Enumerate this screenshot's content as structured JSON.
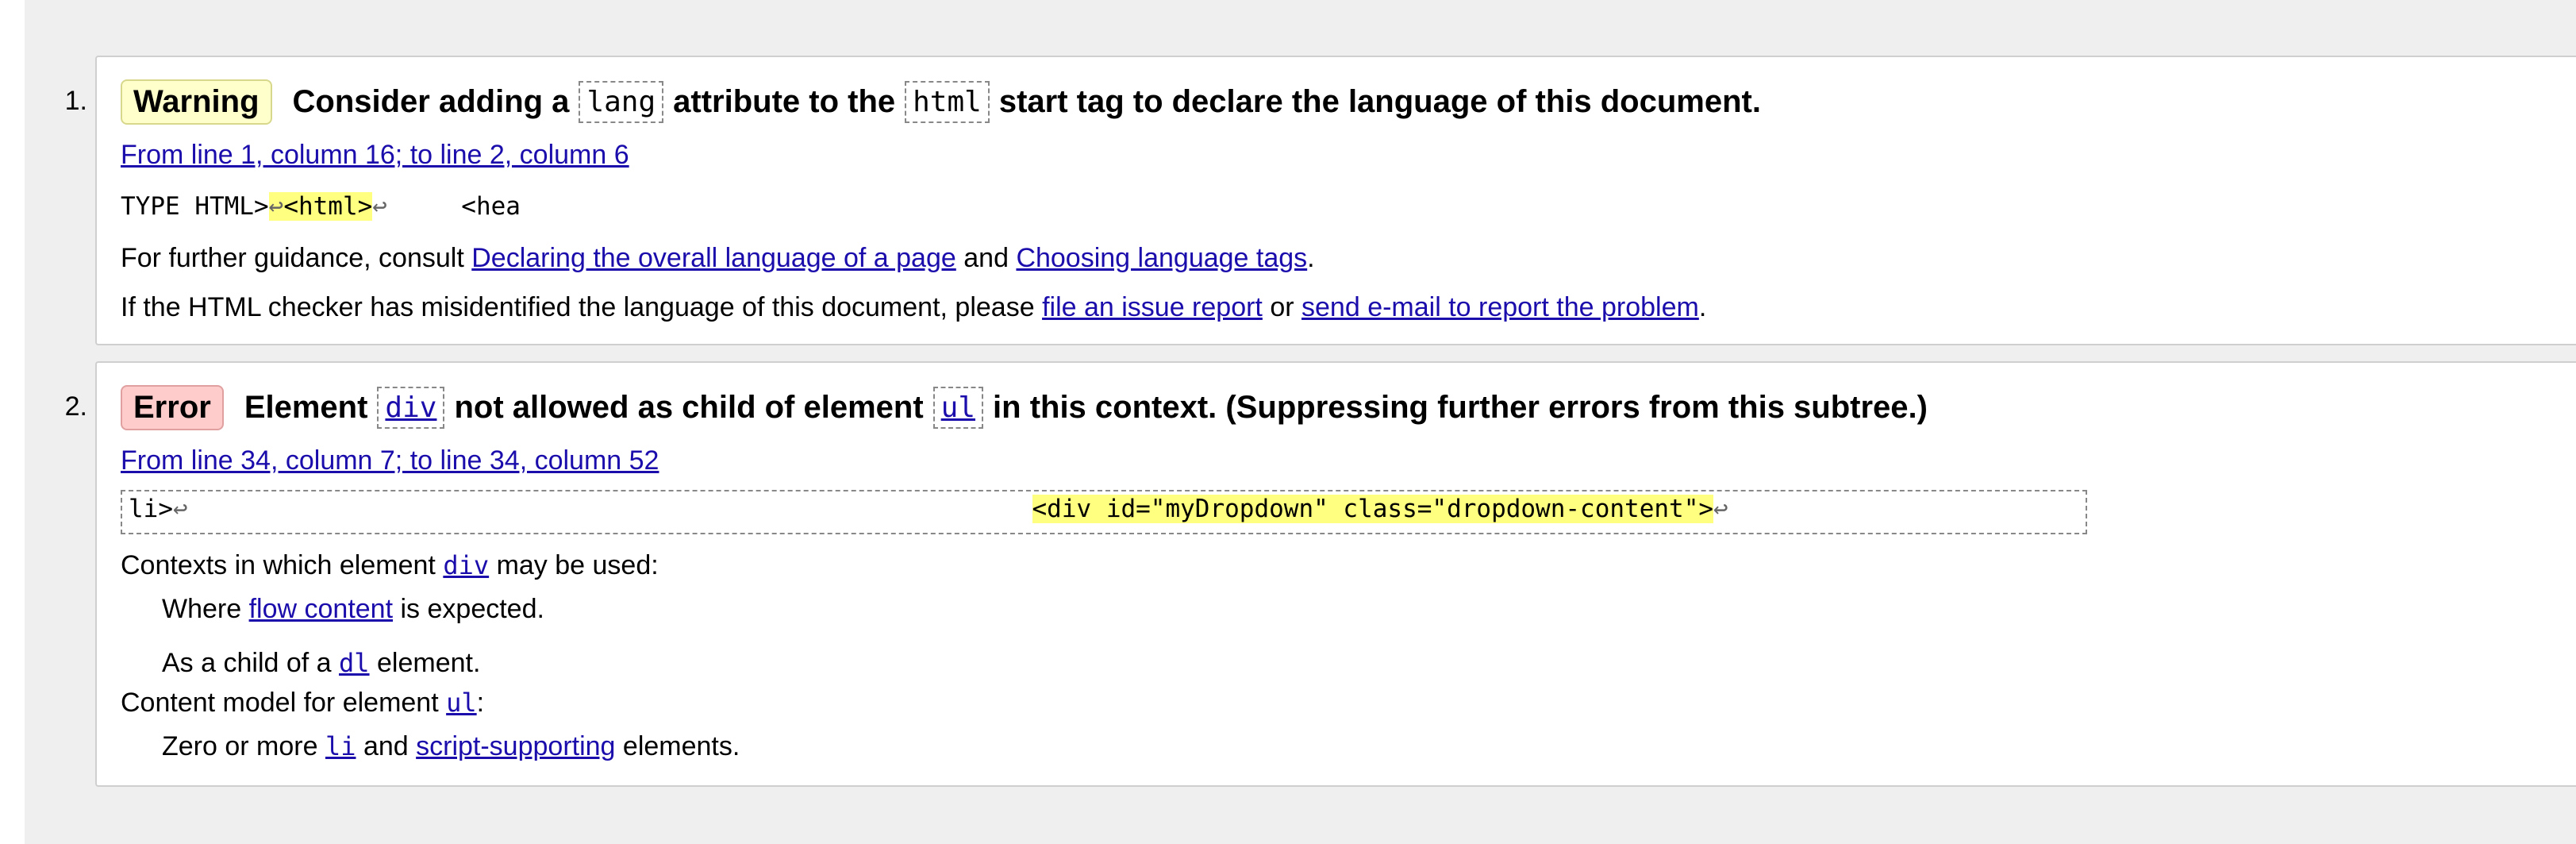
{
  "messages": [
    {
      "number": "1.",
      "badge": "Warning",
      "head_prefix": "Consider adding a",
      "code1": "lang",
      "head_mid": "attribute to the",
      "code2": "html",
      "head_suffix": "start tag to declare the language of this document.",
      "location": "From line 1, column 16; to line 2, column 6",
      "extract_before": "TYPE HTML>",
      "extract_ret1": "↩",
      "extract_hl": "<html>",
      "extract_ret2": "↩",
      "extract_after": "     <hea",
      "guidance_prefix": "For further guidance, consult",
      "guidance_link1": "Declaring the overall language of a page",
      "guidance_and": "and",
      "guidance_link2": "Choosing language tags",
      "guidance_end": ".",
      "misid_prefix": "If the HTML checker has misidentified the language of this document, please",
      "misid_link1": "file an issue report",
      "misid_or": "or",
      "misid_link2": "send e-mail to report the problem",
      "misid_end": "."
    },
    {
      "number": "2.",
      "badge": "Error",
      "head_prefix": "Element",
      "code1": "div",
      "head_mid": "not allowed as child of element",
      "code2": "ul",
      "head_suffix": "in this context. (Suppressing further errors from this subtree.)",
      "location": "From line 34, column 7; to line 34, column 52",
      "extract_before": "li>",
      "extract_ret1": "↩",
      "extract_gap": "                                                         ",
      "extract_hl": "<div id=\"myDropdown\" class=\"dropdown-content\">",
      "extract_ret2": "↩",
      "contexts_prefix": "Contexts in which element",
      "contexts_code": "div",
      "contexts_suffix": "may be used:",
      "where_prefix": "Where",
      "where_link": "flow content",
      "where_suffix": "is expected.",
      "child_prefix": "As a child of a",
      "child_code": "dl",
      "child_suffix": "element.",
      "model_prefix": "Content model for element",
      "model_code": "ul",
      "model_suffix": ":",
      "zero_prefix": "Zero or more",
      "zero_code": "li",
      "zero_and": "and",
      "zero_link": "script-supporting",
      "zero_suffix": "elements."
    }
  ]
}
